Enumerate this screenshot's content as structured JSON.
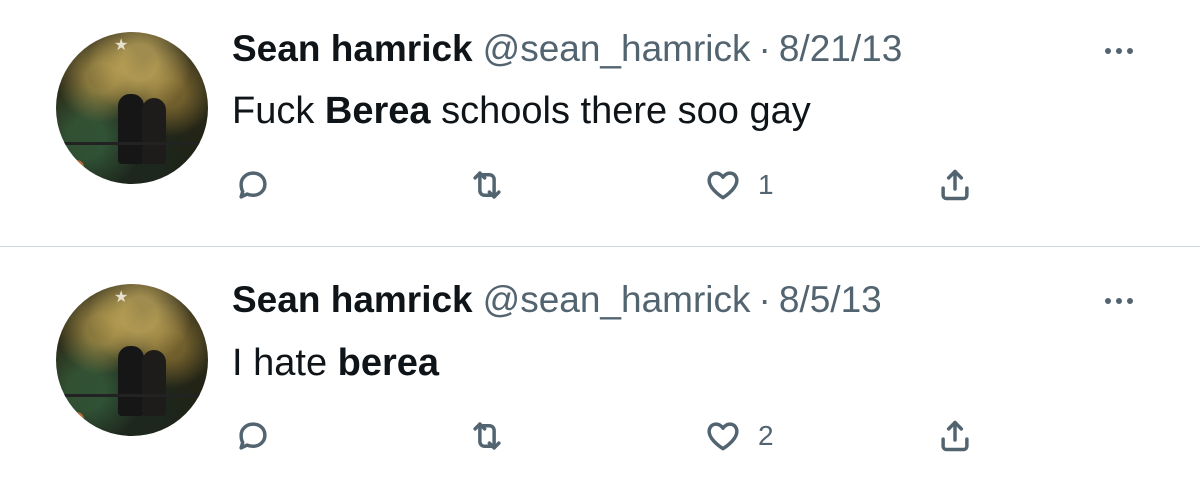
{
  "tweets": [
    {
      "author_name": "Sean hamrick",
      "handle": "@sean_hamrick",
      "separator": "·",
      "date": "8/21/13",
      "text_before": "Fuck ",
      "text_bold": "Berea",
      "text_after": " schools there soo gay",
      "like_count": "1",
      "avatar_icon": "profile-photo"
    },
    {
      "author_name": "Sean hamrick",
      "handle": "@sean_hamrick",
      "separator": "·",
      "date": "8/5/13",
      "text_before": "I hate ",
      "text_bold": "berea",
      "text_after": "",
      "like_count": "2",
      "avatar_icon": "profile-photo"
    }
  ],
  "icons": {
    "reply": "reply-icon",
    "retweet": "retweet-icon",
    "like": "heart-icon",
    "share": "share-icon",
    "more": "more-icon"
  },
  "colors": {
    "text_primary": "#0f1419",
    "text_secondary": "#536471",
    "divider": "#cfd9de"
  }
}
